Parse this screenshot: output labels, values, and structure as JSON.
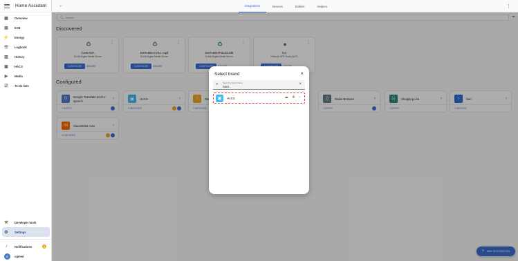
{
  "app": {
    "title": "Home Assistant"
  },
  "sidebar": {
    "items": [
      {
        "label": "Overview",
        "icon": "view-dashboard-icon",
        "glyph": "▦"
      },
      {
        "label": "0AB",
        "icon": "dashboard-icon",
        "glyph": "▤"
      },
      {
        "label": "Energy",
        "icon": "lightning-icon",
        "glyph": "⚡"
      },
      {
        "label": "Logbook",
        "icon": "logbook-icon",
        "glyph": "☰"
      },
      {
        "label": "History",
        "icon": "history-icon",
        "glyph": "▥"
      },
      {
        "label": "HACS",
        "icon": "hacs-icon",
        "glyph": "▣"
      },
      {
        "label": "Media",
        "icon": "media-icon",
        "glyph": "▶"
      },
      {
        "label": "To-do lists",
        "icon": "checklist-icon",
        "glyph": "☑"
      }
    ],
    "developer_tools": "Developer tools",
    "settings": "Settings",
    "notifications": "Notifications",
    "notifications_badge": "1",
    "user": "cgmeri",
    "user_initial": "C"
  },
  "topbar": {
    "tabs": [
      "Integrations",
      "Devices",
      "Entities",
      "Helpers"
    ]
  },
  "search": {
    "placeholder": "Search"
  },
  "discovered": {
    "title": "Discovered",
    "cards": [
      {
        "name": "CHIKAMA",
        "sub": "DLNA Digital Media Server",
        "configure": "CONFIGURE",
        "ignore": "IGNORE",
        "logo": "♻"
      },
      {
        "name": "DXP4800-CYE1: mpd",
        "sub": "DLNA Digital Media Server",
        "configure": "CONFIGURE",
        "ignore": "IGNORE",
        "logo": "♻"
      },
      {
        "name": "DXP4800TP2L03.235",
        "sub": "DLNA Digital Media Server",
        "configure": "CONFIGURE",
        "ignore": "IGNORE",
        "logo": "♻"
      },
      {
        "name": "nut",
        "sub": "Network UPS Tools (NUT)",
        "configure": "CONFIGURE",
        "ignore": "IGNORE",
        "logo": "●"
      }
    ]
  },
  "configured": {
    "title": "Configured",
    "cards": [
      {
        "name": "Google Translate text-to-speech",
        "count": "1 ENTITY",
        "logo": "G",
        "color": "#4a7cc6"
      },
      {
        "name": "HACS",
        "count": "3 SERVICES",
        "logo": "▣",
        "color": "#41bdf5"
      },
      {
        "name": "Rad",
        "count": "2 SERVICES",
        "logo": "⌂",
        "color": "#f5a623"
      },
      {
        "name": "Radio Browser",
        "count": "1 ENTRY",
        "logo": "))",
        "color": "#607d8b"
      },
      {
        "name": "Shopping List",
        "count": "1 ENTRY",
        "logo": "☷",
        "color": "#2d8a7a"
      },
      {
        "name": "Sun",
        "count": "1 SERVICE",
        "logo": "☼",
        "color": "#2d6ad5"
      },
      {
        "name": "XiaomiMiot Auto",
        "count": "13 DEVICES",
        "logo": "mi",
        "color": "#ff6900"
      }
    ]
  },
  "dialog": {
    "title": "Select brand",
    "search_label": "Search a brand name",
    "search_value": "hacs",
    "result_name": "HACS",
    "result_icons": "☁ ⎈ ›"
  },
  "fab": {
    "label": "ADD INTEGRATION"
  }
}
